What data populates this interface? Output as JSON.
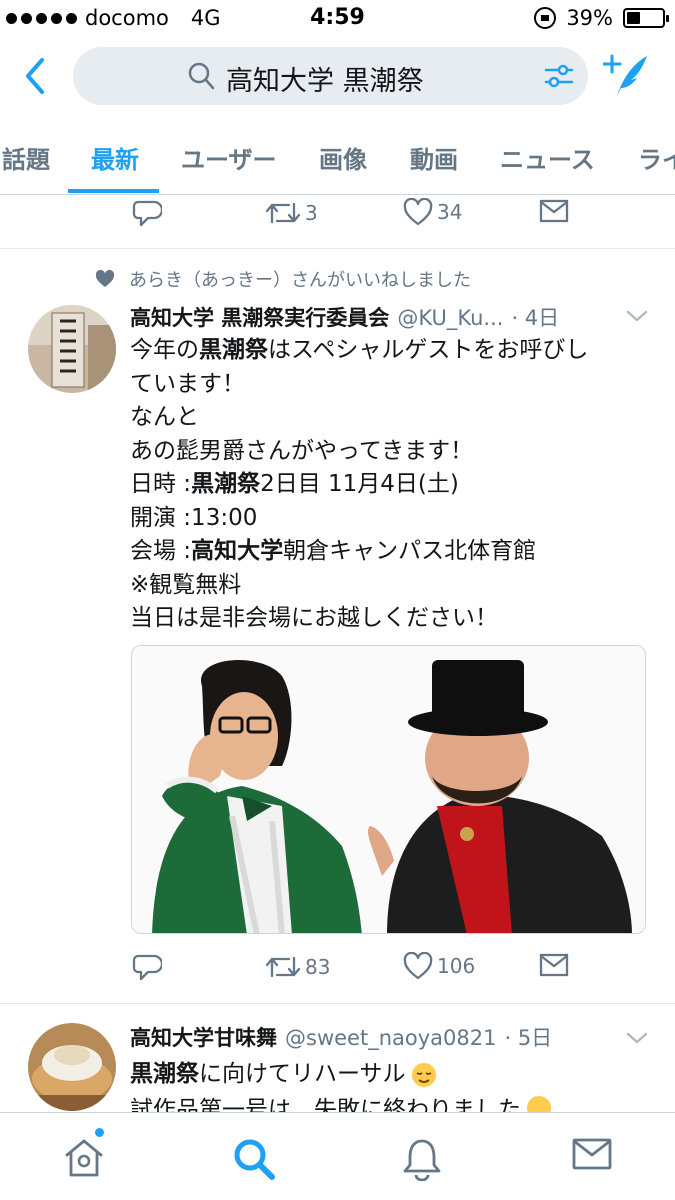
{
  "status": {
    "carrier": "docomo",
    "network": "4G",
    "time": "4:59",
    "battery": "39%",
    "battery_level": 0.39
  },
  "search": {
    "query": "高知大学 黒潮祭"
  },
  "tabs": [
    "話題",
    "最新",
    "ユーザー",
    "画像",
    "動画",
    "ニュース",
    "ライ"
  ],
  "active_tab": "最新",
  "prev_tweet": {
    "retweets": "3",
    "likes": "34"
  },
  "tweet1": {
    "liked_by": "あらき（あっきー）さんがいいねしました",
    "name": "高知大学  黒潮祭実行委員会",
    "handle": "@KU_Ku...",
    "time": "· 4日",
    "lines": [
      [
        {
          "t": "今年の"
        },
        {
          "t": "黒潮祭",
          "b": true
        },
        {
          "t": "はスペシャルゲストをお呼びし"
        }
      ],
      [
        {
          "t": "ています！"
        }
      ],
      [
        {
          "t": "なんと"
        }
      ],
      [
        {
          "t": "あの髭男爵さんがやってきます！"
        }
      ],
      [
        {
          "t": "日時 :"
        },
        {
          "t": "黒潮祭",
          "b": true
        },
        {
          "t": "2日目 11月4日(土)"
        }
      ],
      [
        {
          "t": "開演 :13:00"
        }
      ],
      [
        {
          "t": "会場 :"
        },
        {
          "t": "高知大学",
          "b": true
        },
        {
          "t": "朝倉キャンパス北体育館"
        }
      ],
      [
        {
          "t": "※観覧無料"
        }
      ],
      [
        {
          "t": "当日は是非会場にお越しください！"
        }
      ]
    ],
    "retweets": "83",
    "likes": "106"
  },
  "tweet2": {
    "name": "高知大学甘味舞",
    "handle": "@sweet_naoya0821",
    "time": "· 5日",
    "line1": [
      {
        "t": "黒潮祭",
        "b": true
      },
      {
        "t": "に向けてリハーサル"
      }
    ],
    "line2": "試作品第一号は、失敗に終わりました"
  },
  "icons": {
    "back": "chevron-left-icon",
    "search": "search-icon",
    "filter": "filter-sliders-icon",
    "compose": "compose-quill-icon",
    "reply": "reply-icon",
    "retweet": "retweet-icon",
    "like": "heart-icon",
    "dm": "envelope-icon",
    "home": "home-icon",
    "explore": "explore-search-icon",
    "notifications": "bell-icon",
    "messages": "envelope-icon"
  },
  "colors": {
    "accent": "#1da1f2",
    "secondary_text": "#657786",
    "search_bg": "#e6ecf0"
  }
}
